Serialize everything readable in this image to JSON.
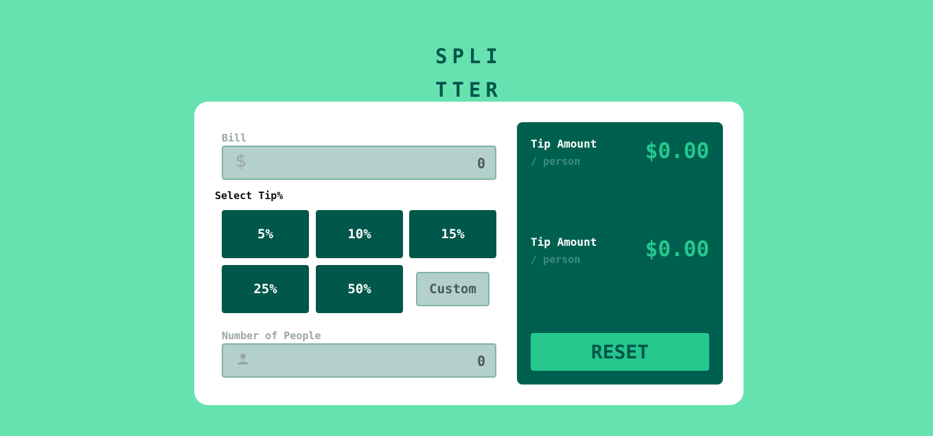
{
  "logo": {
    "line1": "SPLI",
    "line2": "TTER"
  },
  "bill": {
    "label": "Bill",
    "icon": "dollar-icon",
    "icon_glyph": "$",
    "value": "0"
  },
  "tip": {
    "label": "Select Tip%",
    "options": [
      "5%",
      "10%",
      "15%",
      "25%",
      "50%"
    ],
    "custom_label": "Custom"
  },
  "people": {
    "label": "Number of People",
    "icon": "person-icon",
    "value": "0"
  },
  "results": {
    "tip_amount": {
      "title": "Tip Amount",
      "sub": "/ person",
      "amount": "$0.00"
    },
    "total": {
      "title": "Tip Amount",
      "sub": "/ person",
      "amount": "$0.00"
    },
    "reset_label": "RESET"
  },
  "colors": {
    "background": "#66e2b0",
    "dark_green": "#00574a",
    "accent": "#25c88c",
    "input_bg": "#b4d0ca"
  }
}
